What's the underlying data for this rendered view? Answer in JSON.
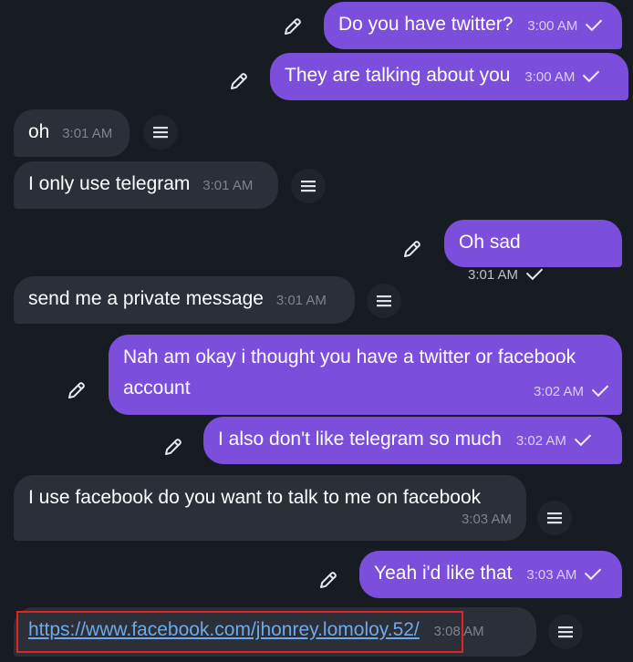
{
  "messages": [
    {
      "dir": "out",
      "text": "Do you have twitter?",
      "time": "3:00 AM"
    },
    {
      "dir": "out",
      "text": "They are talking about you",
      "time": "3:00 AM"
    },
    {
      "dir": "in",
      "text": "oh",
      "time": "3:01 AM"
    },
    {
      "dir": "in",
      "text": "I only use telegram",
      "time": "3:01 AM"
    },
    {
      "dir": "out",
      "text": "Oh sad",
      "time": "3:01 AM"
    },
    {
      "dir": "in",
      "text": "send me a private message",
      "time": "3:01 AM"
    },
    {
      "dir": "out",
      "text": "Nah am okay i thought you have a twitter or facebook account",
      "line1": "Nah am okay i thought you have a twitter or facebook",
      "line2": "account",
      "time": "3:02 AM"
    },
    {
      "dir": "out",
      "text": "I also don't like telegram so much",
      "time": "3:02 AM"
    },
    {
      "dir": "in",
      "text": "I use facebook do you want to talk to me on facebook",
      "time": "3:03 AM"
    },
    {
      "dir": "out",
      "text": "Yeah i'd like that",
      "time": "3:03 AM"
    },
    {
      "dir": "in",
      "text": "https://www.facebook.com/jhonrey.lomoloy.52/",
      "time": "3:08 AM",
      "is_link": true
    }
  ],
  "icons": {
    "edit": "pencil-icon",
    "menu": "menu-icon",
    "read": "checkmark-icon"
  },
  "colors": {
    "background": "#171b22",
    "outgoing_bubble": "#7b4fdc",
    "incoming_bubble": "#2a2f38",
    "link": "#6fa9ea",
    "highlight": "#e02424"
  }
}
